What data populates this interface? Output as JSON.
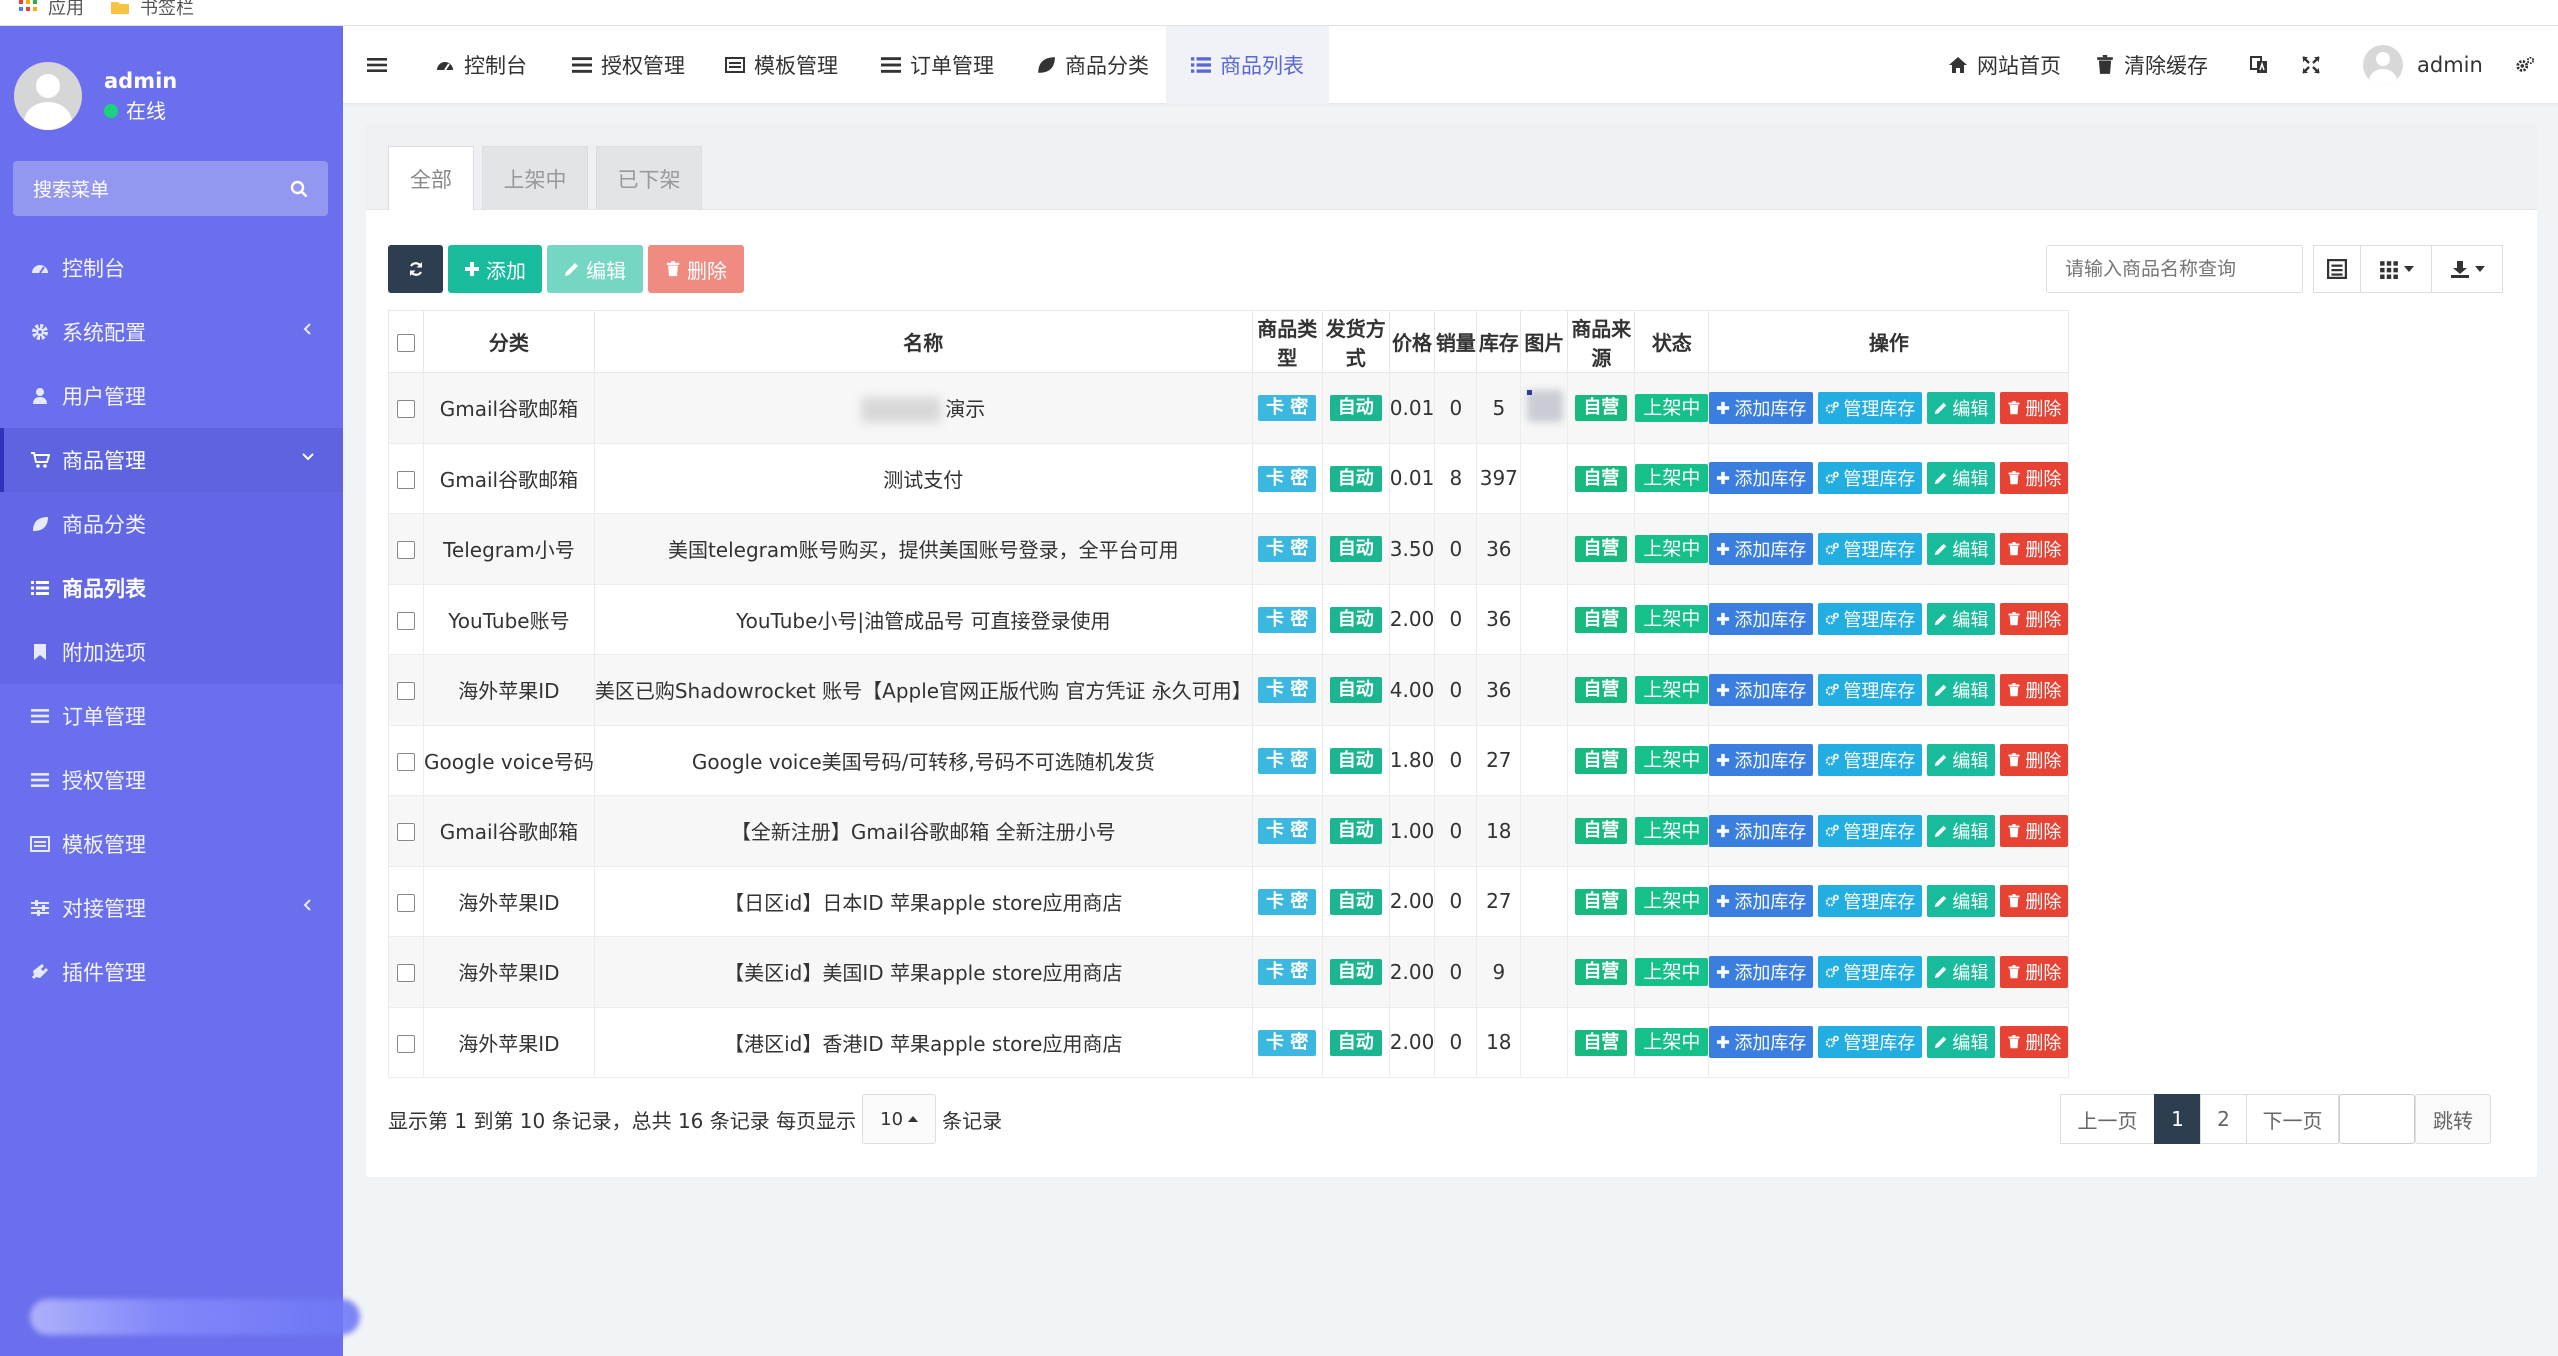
{
  "bookmarks": {
    "apps_label": "应用",
    "bookmarks_label": "书签栏"
  },
  "sidebar": {
    "username": "admin",
    "status": "在线",
    "search_placeholder": "搜索菜单",
    "items": [
      {
        "label": "控制台",
        "icon": "dashboard-icon"
      },
      {
        "label": "系统配置",
        "icon": "gear-icon"
      },
      {
        "label": "用户管理",
        "icon": "user-icon"
      },
      {
        "label": "商品管理",
        "icon": "cart-icon"
      },
      {
        "label": "商品分类",
        "icon": "leaf-icon"
      },
      {
        "label": "商品列表",
        "icon": "list-icon"
      },
      {
        "label": "附加选项",
        "icon": "bookmark-icon"
      },
      {
        "label": "订单管理",
        "icon": "bars-icon"
      },
      {
        "label": "授权管理",
        "icon": "bars-icon"
      },
      {
        "label": "模板管理",
        "icon": "template-icon"
      },
      {
        "label": "对接管理",
        "icon": "sliders-icon"
      },
      {
        "label": "插件管理",
        "icon": "plug-icon"
      }
    ]
  },
  "topnav": {
    "tabs": [
      {
        "label": "控制台"
      },
      {
        "label": "授权管理"
      },
      {
        "label": "模板管理"
      },
      {
        "label": "订单管理"
      },
      {
        "label": "商品分类"
      },
      {
        "label": "商品列表"
      }
    ],
    "home_label": "网站首页",
    "clear_cache_label": "清除缓存",
    "admin_label": "admin"
  },
  "panel": {
    "tabs": [
      "全部",
      "上架中",
      "已下架"
    ],
    "toolbar": {
      "add": "添加",
      "edit": "编辑",
      "delete": "删除"
    },
    "search_placeholder": "请输入商品名称查询"
  },
  "table": {
    "headers": [
      "分类",
      "名称",
      "商品类型",
      "发货方式",
      "价格",
      "销量",
      "库存",
      "图片",
      "商品来源",
      "状态",
      "操作"
    ],
    "rows": [
      {
        "category": "Gmail谷歌邮箱",
        "name": "演示",
        "type": "卡 密",
        "delivery": "自动",
        "price": "0.01",
        "sales": "0",
        "stock": "5",
        "source": "自营",
        "status": "上架中"
      },
      {
        "category": "Gmail谷歌邮箱",
        "name": "测试支付",
        "type": "卡 密",
        "delivery": "自动",
        "price": "0.01",
        "sales": "8",
        "stock": "397",
        "source": "自营",
        "status": "上架中"
      },
      {
        "category": "Telegram小号",
        "name": "美国telegram账号购买，提供美国账号登录，全平台可用",
        "type": "卡 密",
        "delivery": "自动",
        "price": "3.50",
        "sales": "0",
        "stock": "36",
        "source": "自营",
        "status": "上架中"
      },
      {
        "category": "YouTube账号",
        "name": "YouTube小号|油管成品号 可直接登录使用",
        "type": "卡 密",
        "delivery": "自动",
        "price": "2.00",
        "sales": "0",
        "stock": "36",
        "source": "自营",
        "status": "上架中"
      },
      {
        "category": "海外苹果ID",
        "name": "美区已购Shadowrocket 账号【Apple官网正版代购 官方凭证 永久可用】",
        "type": "卡 密",
        "delivery": "自动",
        "price": "4.00",
        "sales": "0",
        "stock": "36",
        "source": "自营",
        "status": "上架中"
      },
      {
        "category": "Google voice号码",
        "name": "Google voice美国号码/可转移,号码不可选随机发货",
        "type": "卡 密",
        "delivery": "自动",
        "price": "1.80",
        "sales": "0",
        "stock": "27",
        "source": "自营",
        "status": "上架中"
      },
      {
        "category": "Gmail谷歌邮箱",
        "name": "【全新注册】Gmail谷歌邮箱 全新注册小号",
        "type": "卡 密",
        "delivery": "自动",
        "price": "1.00",
        "sales": "0",
        "stock": "18",
        "source": "自营",
        "status": "上架中"
      },
      {
        "category": "海外苹果ID",
        "name": "【日区id】日本ID 苹果apple store应用商店",
        "type": "卡 密",
        "delivery": "自动",
        "price": "2.00",
        "sales": "0",
        "stock": "27",
        "source": "自营",
        "status": "上架中"
      },
      {
        "category": "海外苹果ID",
        "name": "【美区id】美国ID 苹果apple store应用商店",
        "type": "卡 密",
        "delivery": "自动",
        "price": "2.00",
        "sales": "0",
        "stock": "9",
        "source": "自营",
        "status": "上架中"
      },
      {
        "category": "海外苹果ID",
        "name": "【港区id】香港ID 苹果apple store应用商店",
        "type": "卡 密",
        "delivery": "自动",
        "price": "2.00",
        "sales": "0",
        "stock": "18",
        "source": "自营",
        "status": "上架中"
      }
    ],
    "ops": {
      "add_stock": "添加库存",
      "manage_stock": "管理库存",
      "edit": "编辑",
      "delete": "删除"
    }
  },
  "footer": {
    "summary": "显示第 1 到第 10 条记录，总共 16 条记录 每页显示",
    "page_size": "10",
    "suffix": "条记录",
    "prev": "上一页",
    "pages": [
      "1",
      "2"
    ],
    "next": "下一页",
    "jump": "跳转"
  },
  "colors": {
    "sidebar": "#6a6fed",
    "accent": "#5a67d8",
    "green": "#18bc9c",
    "red": "#e64335",
    "blue": "#3a7ee0",
    "dark": "#2c3e50"
  }
}
